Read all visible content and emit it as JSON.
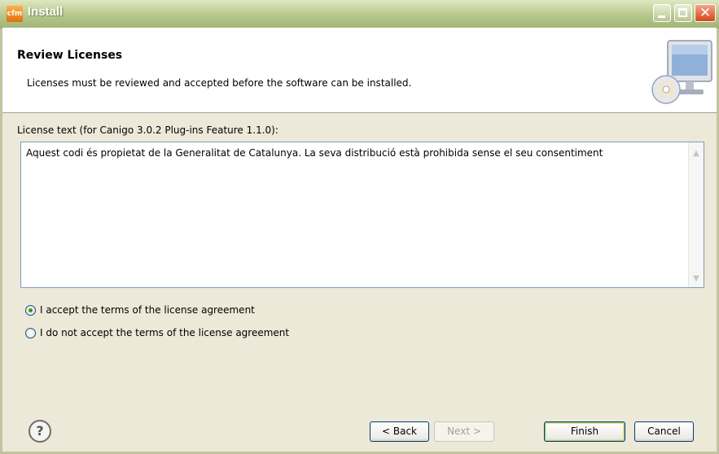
{
  "window": {
    "title": "Install",
    "app_icon_text": "cfm",
    "close_glyph": "✕"
  },
  "header": {
    "title": "Review Licenses",
    "description": "Licenses must be reviewed and accepted before the software can be installed.",
    "icon": "monitor-cd-icon"
  },
  "license": {
    "label": "License text (for Canigo 3.0.2 Plug-ins Feature 1.1.0):",
    "text": "Aquest codi és propietat de la Generalitat de Catalunya. La seva distribució està prohibida sense el seu consentiment"
  },
  "options": [
    {
      "label": "I accept the terms of the license agreement",
      "selected": true
    },
    {
      "label": "I do not accept the terms of the license agreement",
      "selected": false
    }
  ],
  "footer": {
    "help_glyph": "?",
    "back_label": "< Back",
    "next_label": "Next >",
    "finish_label": "Finish",
    "cancel_label": "Cancel"
  },
  "colors": {
    "titlebar": "#b4c48a",
    "dialog_bg": "#ece9d8",
    "radio_selected": "#21a121"
  }
}
